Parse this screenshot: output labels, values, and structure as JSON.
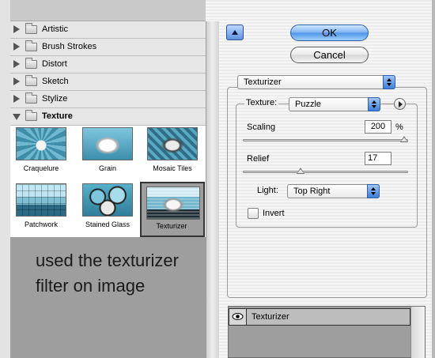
{
  "filter_gallery": {
    "categories": [
      {
        "label": "Artistic",
        "expanded": false
      },
      {
        "label": "Brush Strokes",
        "expanded": false
      },
      {
        "label": "Distort",
        "expanded": false
      },
      {
        "label": "Sketch",
        "expanded": false
      },
      {
        "label": "Stylize",
        "expanded": false
      },
      {
        "label": "Texture",
        "expanded": true
      }
    ],
    "texture_filters": [
      {
        "label": "Craquelure",
        "selected": false
      },
      {
        "label": "Grain",
        "selected": false
      },
      {
        "label": "Mosaic Tiles",
        "selected": false
      },
      {
        "label": "Patchwork",
        "selected": false
      },
      {
        "label": "Stained Glass",
        "selected": false
      },
      {
        "label": "Texturizer",
        "selected": true
      }
    ]
  },
  "annotation": {
    "text": "used the texturizer filter on image"
  },
  "buttons": {
    "ok": "OK",
    "cancel": "Cancel"
  },
  "settings": {
    "filter_select": "Texturizer",
    "texture_label": "Texture:",
    "texture_value": "Puzzle",
    "scaling_label": "Scaling",
    "scaling_value": "200",
    "scaling_unit": "%",
    "scaling_level": 1.0,
    "relief_label": "Relief",
    "relief_value": "17",
    "relief_level": 0.34,
    "light_label": "Light:",
    "light_value": "Top Right",
    "invert_label": "Invert",
    "invert_checked": false
  },
  "layers": {
    "items": [
      {
        "label": "Texturizer",
        "visible": true
      }
    ]
  },
  "colors": {
    "accent": "#4c93e6",
    "preview_gray": "#9e9e9e"
  },
  "icons": {
    "collapse": "triangle-up-icon",
    "folder": "folder-icon",
    "disclosure": "disclosure-triangle-icon",
    "menu": "circle-arrow-menu-icon",
    "eye": "eye-icon"
  }
}
